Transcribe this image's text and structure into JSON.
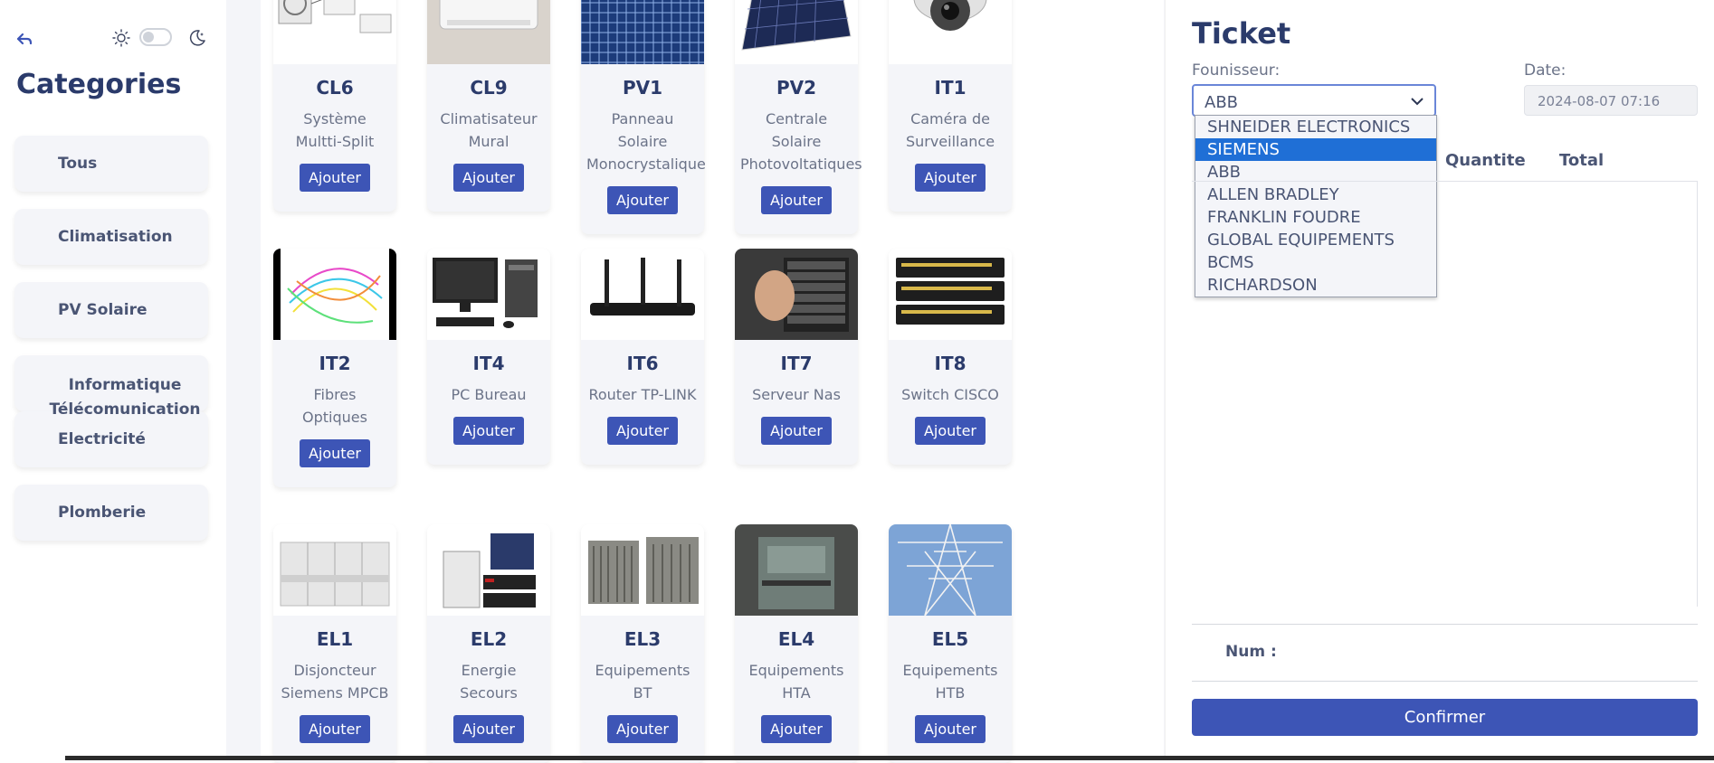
{
  "sidebar": {
    "title": "Categories",
    "items": [
      {
        "label": "Tous"
      },
      {
        "label": "Climatisation"
      },
      {
        "label": "PV Solaire"
      },
      {
        "label": "Informatique Télécomunication"
      },
      {
        "label": "Electricité"
      },
      {
        "label": "Plomberie"
      }
    ]
  },
  "products": [
    {
      "code": "CL6",
      "name": "Système Multti-Split",
      "button": "Ajouter",
      "img": "multisplit-image"
    },
    {
      "code": "CL9",
      "name": "Climatisateur Mural",
      "button": "Ajouter",
      "img": "wall-ac-image"
    },
    {
      "code": "PV1",
      "name": "Panneau Solaire Monocrystalique",
      "button": "Ajouter",
      "img": "solar-panel-field-image"
    },
    {
      "code": "PV2",
      "name": "Centrale Solaire Photovoltatiques",
      "button": "Ajouter",
      "img": "solar-panel-image"
    },
    {
      "code": "IT1",
      "name": "Caméra de Surveillance",
      "button": "Ajouter",
      "img": "dome-camera-image"
    },
    {
      "code": "IT2",
      "name": "Fibres Optiques",
      "button": "Ajouter",
      "img": "fiber-optic-image"
    },
    {
      "code": "IT4",
      "name": "PC Bureau",
      "button": "Ajouter",
      "img": "desktop-pc-image"
    },
    {
      "code": "IT6",
      "name": "Router TP-LINK",
      "button": "Ajouter",
      "img": "router-image"
    },
    {
      "code": "IT7",
      "name": "Serveur Nas",
      "button": "Ajouter",
      "img": "nas-server-image"
    },
    {
      "code": "IT8",
      "name": "Switch CISCO",
      "button": "Ajouter",
      "img": "network-switch-image"
    },
    {
      "code": "EL1",
      "name": "Disjoncteur Siemens MPCB",
      "button": "Ajouter",
      "img": "circuit-breaker-image"
    },
    {
      "code": "EL2",
      "name": "Energie Secours",
      "button": "Ajouter",
      "img": "backup-energy-image"
    },
    {
      "code": "EL3",
      "name": "Equipements BT",
      "button": "Ajouter",
      "img": "transformer-image"
    },
    {
      "code": "EL4",
      "name": "Equipements HTA",
      "button": "Ajouter",
      "img": "hta-equipment-image"
    },
    {
      "code": "EL5",
      "name": "Equipements HTB",
      "button": "Ajouter",
      "img": "pylon-image"
    }
  ],
  "ticket": {
    "title": "Ticket",
    "supplier_label": "Founisseur:",
    "supplier_value": "ABB",
    "date_label": "Date:",
    "date_value": "2024-08-07 07:16",
    "supplier_options": [
      "SHNEIDER ELECTRONICS",
      "SIEMENS",
      "ABB",
      "ALLEN BRADLEY",
      "FRANKLIN FOUDRE",
      "GLOBAL EQUIPEMENTS",
      "BCMS",
      "RICHARDSON"
    ],
    "highlighted_option": "SIEMENS",
    "columns": [
      "Quantite",
      "Total"
    ],
    "num_label": "Num :",
    "confirm_label": "Confirmer"
  },
  "colors": {
    "accent": "#3d55b6",
    "title": "#2b3b6b",
    "highlight": "#1f6fd6"
  }
}
